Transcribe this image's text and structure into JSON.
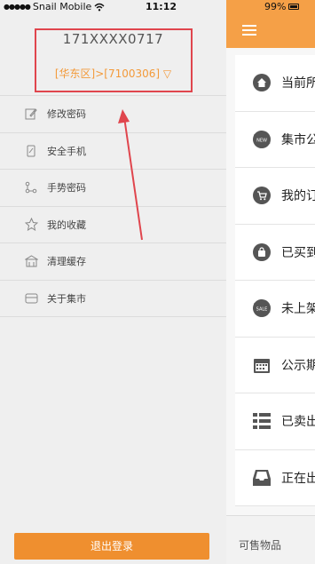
{
  "status_bar": {
    "signal_dots": "●●●●●",
    "carrier": "Snail Mobile",
    "time": "11:12",
    "battery": "99%"
  },
  "drawer": {
    "phone": "171XXXX0717",
    "district": "[华东区]>[7100306] ▽",
    "menu": [
      {
        "label": "修改密码",
        "icon": "edit-icon"
      },
      {
        "label": "安全手机",
        "icon": "phone-icon"
      },
      {
        "label": "手势密码",
        "icon": "gesture-icon"
      },
      {
        "label": "我的收藏",
        "icon": "star-icon"
      },
      {
        "label": "清理缓存",
        "icon": "clean-icon"
      },
      {
        "label": "关于集市",
        "icon": "about-icon"
      }
    ],
    "logout": "退出登录"
  },
  "main": {
    "items": [
      {
        "label": "当前所",
        "icon": "home-icon"
      },
      {
        "label": "集市公",
        "icon": "new-badge-icon"
      },
      {
        "label": "我的订",
        "icon": "cart-icon"
      },
      {
        "label": "已买到",
        "icon": "bag-icon"
      },
      {
        "label": "未上架",
        "icon": "sale-badge-icon"
      },
      {
        "label": "公示期",
        "icon": "calendar-icon"
      },
      {
        "label": "已卖出",
        "icon": "list-icon"
      },
      {
        "label": "正在出",
        "icon": "inbox-icon"
      }
    ],
    "bottom_label": "可售物品"
  },
  "colors": {
    "accent": "#f5a047",
    "button": "#ef8f2f",
    "district_text": "#f39a3a",
    "annotation_red": "#e0454d"
  }
}
